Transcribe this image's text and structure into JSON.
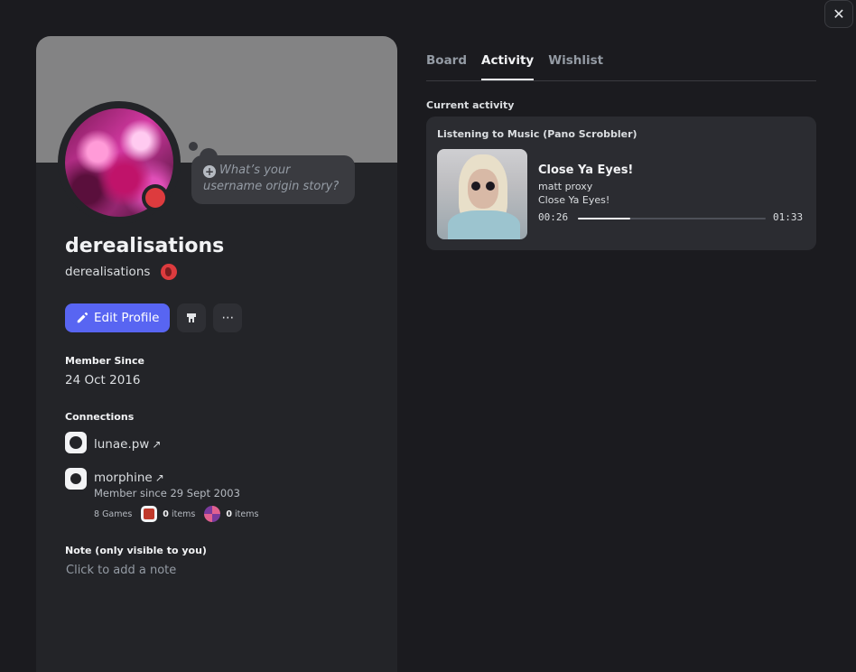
{
  "window": {
    "close_icon": "close-icon"
  },
  "profile": {
    "display_name": "derealisations",
    "username": "derealisations",
    "status_color": "#dd3b3e",
    "banner_color": "#838384",
    "bio_prompt": "What’s your username origin story?",
    "buttons": {
      "edit_profile": "Edit Profile"
    }
  },
  "member_since": {
    "title": "Member Since",
    "value": "24 Oct 2016"
  },
  "connections": {
    "title": "Connections",
    "items": [
      {
        "name": "lunae.pw",
        "icon": "globe-icon"
      },
      {
        "name": "morphine",
        "icon": "steam-icon",
        "subtitle": "Member since 29 Sept 2003"
      }
    ],
    "steam": {
      "games": "8 Games",
      "dota_items_count": "0",
      "tf2_items_count": "0",
      "items_label": "items"
    }
  },
  "note": {
    "title": "Note (only visible to you)",
    "placeholder": "Click to add a note"
  },
  "tabs": [
    {
      "label": "Board",
      "active": false
    },
    {
      "label": "Activity",
      "active": true
    },
    {
      "label": "Wishlist",
      "active": false
    }
  ],
  "activity": {
    "section_title": "Current activity",
    "header": "Listening to Music (Pano Scrobbler)",
    "track_title": "Close Ya Eyes!",
    "artist": "matt proxy",
    "album": "Close Ya Eyes!",
    "elapsed": "00:26",
    "duration": "01:33",
    "progress_fraction": 0.28
  },
  "colors": {
    "accent": "#5865f2",
    "background": "#1b1b1f",
    "card": "#232428"
  }
}
